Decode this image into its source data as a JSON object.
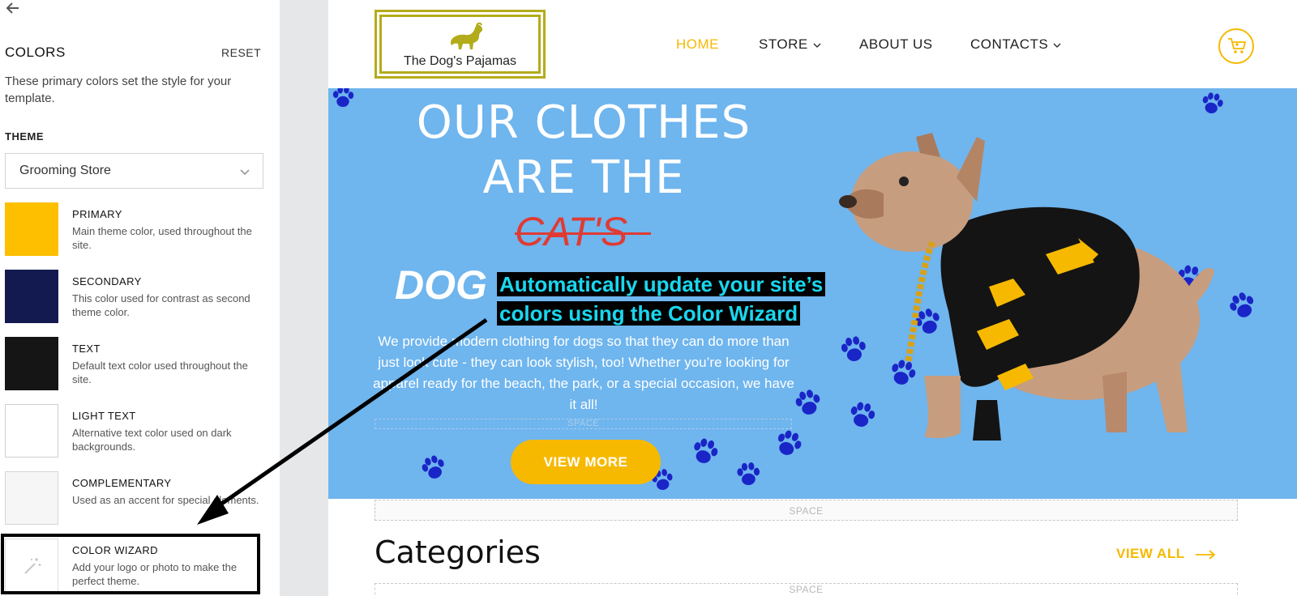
{
  "panel": {
    "title": "COLORS",
    "reset_label": "RESET",
    "description": "These primary colors set the style for your template.",
    "theme_label": "THEME",
    "theme_value": "Grooming Store",
    "swatches": [
      {
        "name": "PRIMARY",
        "desc": "Main theme color, used throughout the site.",
        "color": "#fdbf00"
      },
      {
        "name": "SECONDARY",
        "desc": "This color used for contrast as second theme color.",
        "color": "#131a4f"
      },
      {
        "name": "TEXT",
        "desc": "Default text color used throughout the site.",
        "color": "#151515"
      },
      {
        "name": "LIGHT TEXT",
        "desc": "Alternative text color used on dark backgrounds.",
        "color": "#ffffff"
      },
      {
        "name": "COMPLEMENTARY",
        "desc": "Used as an accent for special elements.",
        "color": "#f6f6f6"
      },
      {
        "name": "COLOR WIZARD",
        "desc": "Add your logo or photo to make the perfect theme.",
        "icon": "magic-wand-icon"
      }
    ]
  },
  "site": {
    "logo_text": "The Dog's Pajamas",
    "nav": {
      "home": "HOME",
      "store": "STORE",
      "about": "ABOUT US",
      "contacts": "CONTACTS"
    },
    "hero": {
      "line1": "OUR CLOTHES",
      "line2": "ARE THE",
      "cats": "CAT'S",
      "dog": "DOG",
      "body": "We provide modern clothing for dogs so that they can do more than just look cute - they can look stylish, too! Whether you’re looking for apparel ready for the beach, the park, or a special occasion, we have it all!",
      "space_label": "SPACE",
      "button": "VIEW MORE"
    },
    "space_label": "SPACE",
    "categories_title": "Categories",
    "view_all": "VIEW ALL"
  },
  "callout": {
    "line1": "Automatically update your site’s",
    "line2": "colors using the Color Wizard"
  },
  "colors": {
    "accent": "#f6b900",
    "hero_bg": "#6fb5ee",
    "callout_text": "#1ad7ef",
    "paw": "#1a25c7"
  }
}
